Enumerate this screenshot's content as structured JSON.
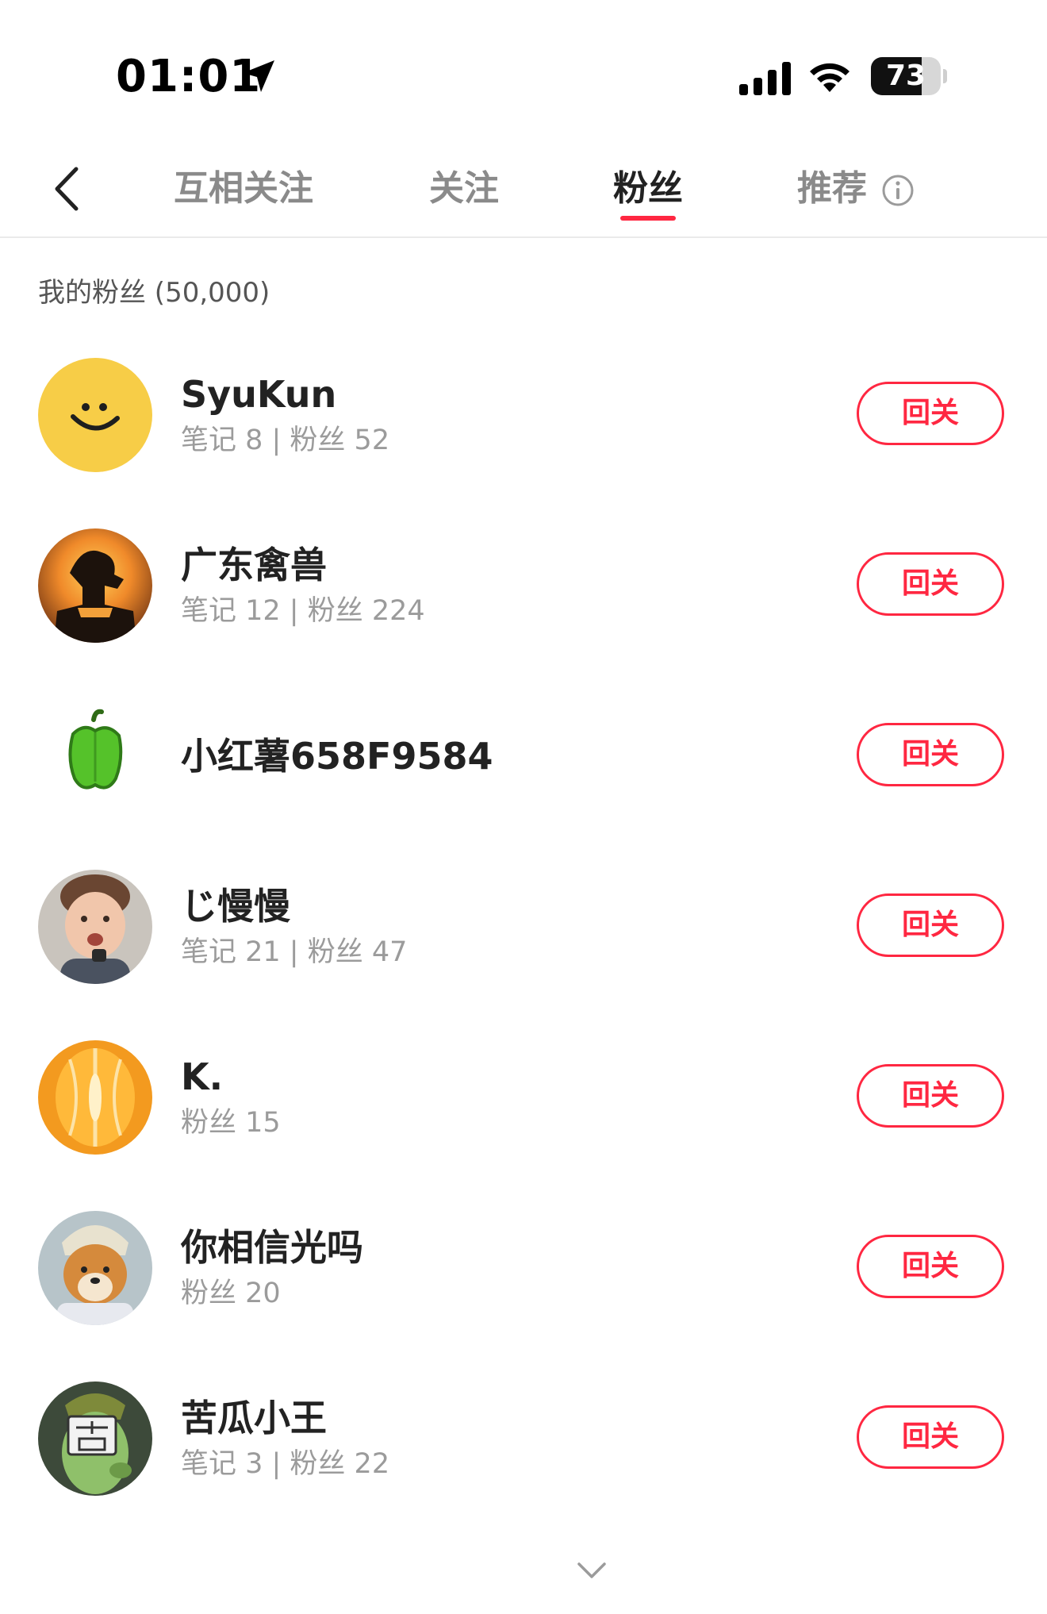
{
  "status_bar": {
    "time": "01:01",
    "battery": "73",
    "battery_level": 0.73,
    "location_icon": "location-arrow-icon",
    "signal_icon": "cellular-signal-icon",
    "wifi_icon": "wifi-icon"
  },
  "nav": {
    "back_icon": "chevron-left-icon",
    "tabs": [
      {
        "label": "互相关注",
        "active": false
      },
      {
        "label": "关注",
        "active": false
      },
      {
        "label": "粉丝",
        "active": true
      },
      {
        "label": "推荐",
        "active": false
      }
    ],
    "info_icon": "info-icon"
  },
  "section": {
    "title": "我的粉丝 (50,000)"
  },
  "followers": [
    {
      "name": "SyuKun",
      "stats": "笔记 8 | 粉丝 52",
      "button": "回关",
      "avatar": "smiley-face-avatar"
    },
    {
      "name": "广东禽兽",
      "stats": "笔记 12 | 粉丝 224",
      "button": "回关",
      "avatar": "sunset-silhouette-avatar"
    },
    {
      "name": "小红薯658F9584",
      "stats": "",
      "button": "回关",
      "avatar": "green-pepper-avatar"
    },
    {
      "name": "じ慢慢",
      "stats": "笔记 21 | 粉丝 47",
      "button": "回关",
      "avatar": "child-photo-avatar"
    },
    {
      "name": "K.",
      "stats": "粉丝 15",
      "button": "回关",
      "avatar": "orange-fruit-avatar"
    },
    {
      "name": "你相信光吗",
      "stats": "粉丝 20",
      "button": "回关",
      "avatar": "shiba-dog-avatar"
    },
    {
      "name": "苦瓜小王",
      "stats": "笔记 3 | 粉丝 22",
      "button": "回关",
      "avatar": "bitter-melon-cartoon-avatar"
    }
  ],
  "colors": {
    "accent": "#ff2741",
    "muted_text": "#9b9b9b",
    "primary_text": "#222222"
  },
  "footer": {
    "more_icon": "chevron-down-icon"
  }
}
